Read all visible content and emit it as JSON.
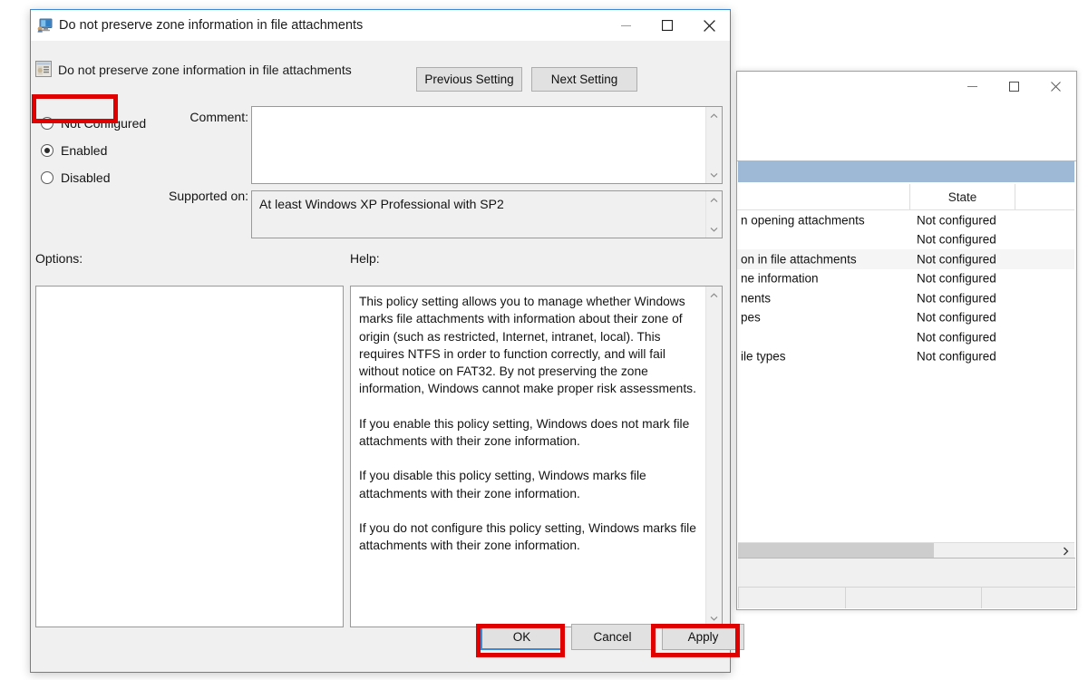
{
  "dialog": {
    "title": "Do not preserve zone information in file attachments",
    "title_icon": "computer-monitor-icon",
    "window_controls": {
      "minimize": "minimize-icon",
      "maximize": "maximize-icon",
      "close": "close-icon"
    },
    "header": {
      "icon": "policy-setting-icon",
      "label": "Do not preserve zone information in file attachments",
      "previous_setting": "Previous Setting",
      "next_setting": "Next Setting"
    },
    "state_options": [
      {
        "label": "Not Configured",
        "selected": false
      },
      {
        "label": "Enabled",
        "selected": true
      },
      {
        "label": "Disabled",
        "selected": false
      }
    ],
    "comment": {
      "label": "Comment:",
      "value": "",
      "placeholder": ""
    },
    "supported_on": {
      "label": "Supported on:",
      "value": "At least Windows XP Professional with SP2"
    },
    "options": {
      "label": "Options:",
      "value": ""
    },
    "help": {
      "label": "Help:",
      "paragraphs": [
        "This policy setting allows you to manage whether Windows marks file attachments with information about their zone of origin (such as restricted, Internet, intranet, local). This requires NTFS in order to function correctly, and will fail without notice on FAT32. By not preserving the zone information, Windows cannot make proper risk assessments.",
        "If you enable this policy setting, Windows does not mark file attachments with their zone information.",
        "If you disable this policy setting, Windows marks file attachments with their zone information.",
        "If you do not configure this policy setting, Windows marks file attachments with their zone information."
      ]
    },
    "footer": {
      "ok": "OK",
      "cancel": "Cancel",
      "apply": "Apply"
    }
  },
  "background_window": {
    "window_controls": {
      "minimize": "minimize-icon",
      "maximize": "maximize-icon",
      "close": "close-icon"
    },
    "columns": {
      "state": "State"
    },
    "rows": [
      {
        "name": "n opening attachments",
        "state": "Not configured"
      },
      {
        "name": "",
        "state": "Not configured"
      },
      {
        "name": "on in file attachments",
        "state": "Not configured"
      },
      {
        "name": "ne information",
        "state": "Not configured"
      },
      {
        "name": "nents",
        "state": "Not configured"
      },
      {
        "name": "pes",
        "state": "Not configured"
      },
      {
        "name": "",
        "state": "Not configured"
      },
      {
        "name": "ile types",
        "state": "Not configured"
      }
    ],
    "scroll_right_icon": "chevron-right-icon"
  },
  "annotations": {
    "highlight_color": "#e00000",
    "boxes": [
      {
        "target": "enabled-radio"
      },
      {
        "target": "ok-button"
      },
      {
        "target": "apply-button"
      }
    ]
  }
}
